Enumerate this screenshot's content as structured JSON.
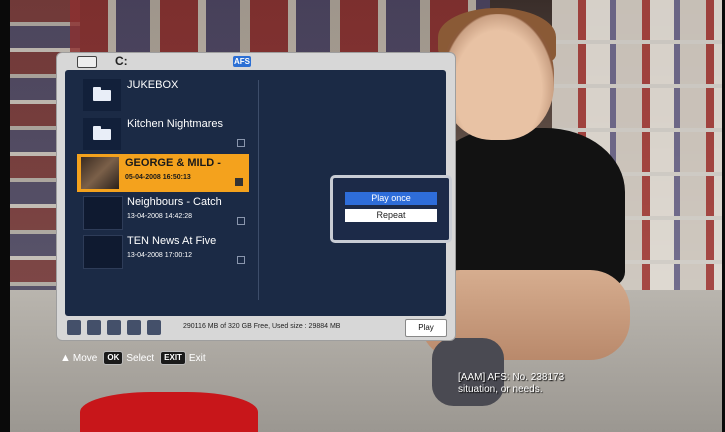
{
  "osd": {
    "drive_label": "C:",
    "badge": "AFS",
    "items": [
      {
        "title": "JUKEBOX",
        "date": "",
        "type": "folder"
      },
      {
        "title": "Kitchen Nightmares",
        "date": "",
        "type": "folder"
      },
      {
        "title": "GEORGE & MILD -",
        "date": "05-04-2008 16:50:13",
        "type": "recording",
        "selected": true
      },
      {
        "title": "Neighbours - Catch",
        "date": "13-04-2008 14:42:28",
        "type": "recording"
      },
      {
        "title": "TEN News At Five",
        "date": "13-04-2008 17:00:12",
        "type": "recording"
      }
    ],
    "storage_status": "290116 MB of 320 GB Free, Used size : 29884 MB",
    "play_label": "Play"
  },
  "popup": {
    "options": [
      "Play once",
      "Repeat"
    ]
  },
  "hints": {
    "move": "Move",
    "ok_key": "OK",
    "select": "Select",
    "exit_key": "EXIT",
    "exit": "Exit"
  },
  "broadcast": {
    "caption_line1": "[AAM] AFS: No. 238173",
    "caption_line2": "situation, or needs."
  },
  "colors": {
    "panel_bg": "#d7d7d7",
    "list_bg": "#1b2a45",
    "selection": "#f4a21d",
    "popup_active": "#2e6dd9",
    "badge": "#2b6fd4"
  },
  "icons": [
    "drive-icon",
    "folder-icon",
    "flag-icon",
    "edit-icon",
    "trash-icon",
    "rename-icon",
    "lock-icon",
    "user-icon",
    "up-down-arrow-icon"
  ]
}
